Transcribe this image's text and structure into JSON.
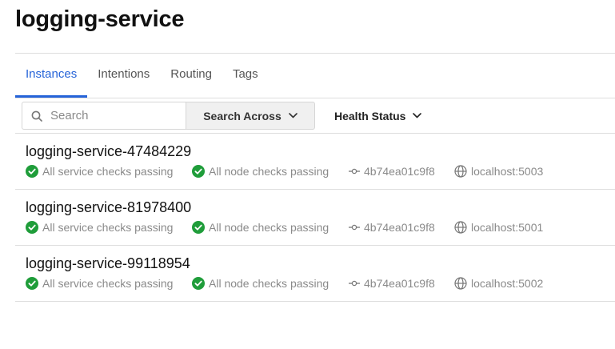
{
  "page": {
    "title": "logging-service"
  },
  "tabs": [
    {
      "label": "Instances",
      "active": true
    },
    {
      "label": "Intentions",
      "active": false
    },
    {
      "label": "Routing",
      "active": false
    },
    {
      "label": "Tags",
      "active": false
    }
  ],
  "filters": {
    "search_placeholder": "Search",
    "search_value": "",
    "search_across_label": "Search Across",
    "health_status_label": "Health Status"
  },
  "colors": {
    "accent": "#2563d8",
    "passing": "#1f9d3a"
  },
  "icons": {
    "search": "search-icon",
    "dropdown": "chevron-down-icon",
    "check": "check-circle-icon",
    "commit": "git-commit-icon",
    "address": "globe-icon"
  },
  "instances": [
    {
      "name": "logging-service-47484229",
      "service_checks": "All service checks passing",
      "node_checks": "All node checks passing",
      "node_id": "4b74ea01c9f8",
      "address": "localhost:5003"
    },
    {
      "name": "logging-service-81978400",
      "service_checks": "All service checks passing",
      "node_checks": "All node checks passing",
      "node_id": "4b74ea01c9f8",
      "address": "localhost:5001"
    },
    {
      "name": "logging-service-99118954",
      "service_checks": "All service checks passing",
      "node_checks": "All node checks passing",
      "node_id": "4b74ea01c9f8",
      "address": "localhost:5002"
    }
  ]
}
